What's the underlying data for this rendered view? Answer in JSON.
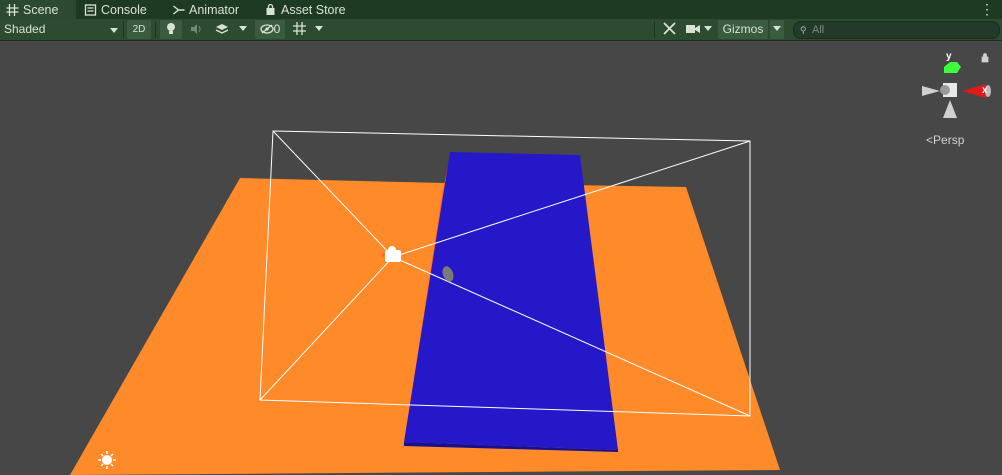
{
  "tabs": [
    {
      "label": "Scene",
      "icon": "grid-icon",
      "active": true
    },
    {
      "label": "Console",
      "icon": "console-icon",
      "active": false
    },
    {
      "label": "Animator",
      "icon": "animator-icon",
      "active": false
    },
    {
      "label": "Asset Store",
      "icon": "store-bag-icon",
      "active": false
    }
  ],
  "toolbar": {
    "draw_mode": "Shaded",
    "mode_2d": "2D",
    "hidden_count": "0",
    "gizmos": "Gizmos",
    "search_placeholder": "All"
  },
  "gizmo": {
    "y_label": "y",
    "x_label": "x",
    "projection": "Persp"
  },
  "colors": {
    "tab_bar": "#1f3a23",
    "toolbar": "#2d4b31",
    "background": "#474747",
    "ground_plane": "#ff8a2a",
    "blue_plane": "#2418c8",
    "axis_y": "#3dff3d",
    "axis_x": "#e01a1a"
  }
}
